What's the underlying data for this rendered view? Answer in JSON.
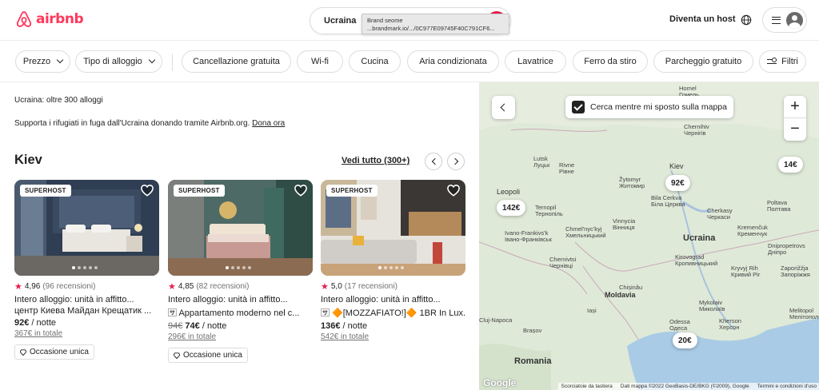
{
  "brand": {
    "name": "airbnb",
    "color": "#ff385c"
  },
  "search": {
    "location": "Ucraina"
  },
  "tooltip": {
    "line1": "Brand seome",
    "line2": "...brandmark.io/.../0C977E09745F40C791CF6..."
  },
  "header": {
    "host_label": "Diventa un host"
  },
  "filters": [
    {
      "label": "Prezzo"
    },
    {
      "label": "Tipo di alloggio"
    },
    {
      "label": "Cancellazione gratuita"
    },
    {
      "label": "Wi-fi"
    },
    {
      "label": "Cucina"
    },
    {
      "label": "Aria condizionata"
    },
    {
      "label": "Lavatrice"
    },
    {
      "label": "Ferro da stiro"
    },
    {
      "label": "Parcheggio gratuito"
    },
    {
      "label": "Filtri"
    }
  ],
  "results": {
    "count": "Ucraina: oltre 300 alloggi",
    "support_text": "Supporta i rifugiati in fuga dall'Ucraina donando tramite Airbnb.org.",
    "support_link": "Dona ora"
  },
  "section": {
    "title": "Kiev",
    "see_all": "Vedi tutto (300+)"
  },
  "listings": [
    {
      "badge": "SUPERHOST",
      "rating": "4,96",
      "reviews": "(96 recensioni)",
      "title": "Intero alloggio: unità in affitto...",
      "subtitle": "центр Киева Майдан Крещатик ...",
      "old_price": "",
      "price": "92€",
      "per": "/ notte",
      "total": "367€ in totale",
      "tag": "Occasione unica"
    },
    {
      "badge": "SUPERHOST",
      "rating": "4,85",
      "reviews": "(82 recensioni)",
      "title": "Intero alloggio: unità in affitto...",
      "subtitle": "🈂 Appartamento moderno nel c...",
      "old_price": "94€",
      "price": "74€",
      "per": "/ notte",
      "total": "296€ in totale",
      "tag": "Occasione unica"
    },
    {
      "badge": "SUPERHOST",
      "rating": "5,0",
      "reviews": "(17 recensioni)",
      "title": "Intero alloggio: unità in affitto...",
      "subtitle": "🈂 🔶[MOZZAFIATO!]🔶 1BR In Lux...",
      "old_price": "",
      "price": "136€",
      "per": "/ notte",
      "total": "542€ in totale",
      "tag": ""
    }
  ],
  "map": {
    "search_moving": "Cerca mentre mi sposto sulla mappa",
    "zoom_in": "+",
    "zoom_out": "−",
    "pins": [
      "92€",
      "142€",
      "14€",
      "20€"
    ],
    "labels": {
      "homel": "Homel\nГомель",
      "chernihiv": "Chernihiv\nЧернігів",
      "lutsk": "Lutsk\nЛуцьк",
      "rivne": "Rivne\nРівне",
      "zhytomyr": "Žytomyr\nЖитомир",
      "kiev": "Kiev",
      "leopoli": "Leopoli",
      "bila": "Bila Cerkva\nБіла Церква",
      "ternopil": "Ternopil\nТернопіль",
      "cherkasy": "Cherkasy\nЧеркаси",
      "poltava": "Poltava\nПолтава",
      "ivano": "Ivano-Frankivs'k\nІвано-Франківськ",
      "khmel": "Chmel'nyc'kyj\nХмельницький",
      "vinnycia": "Vinnycia\nВінниця",
      "kremenchuk": "Kremenčuk\nКременчук",
      "ucraina": "Ucraina",
      "dnipro": "Dnipropetrovs\nДніпро",
      "chernivtsi": "Chernivtsi\nЧернівці",
      "kirovograd": "Kirovograd\nКропивницький",
      "kryvyi": "Kryvyj Rih\nКривий Ріг",
      "zaporizh": "Zaporižžja\nЗапоріжжя",
      "moldavia": "Moldavia",
      "chisinau": "Chișinău",
      "iasi": "Iași",
      "mykolaiv": "Mykolaiv\nМиколаїв",
      "cluj": "Cluj-Napoca",
      "odessa": "Odessa\nОдеса",
      "kherson": "Kherson\nХерсон",
      "melitopol": "Melitopol\nМелітополь",
      "brasov": "Brașov",
      "romania": "Romania"
    },
    "attribution": {
      "shortcuts": "Scorciatoie da tastiera",
      "data": "Dati mappa ©2022 GeoBasis-DE/BKG (©2009), Google",
      "terms": "Termini e condizioni d'uso"
    },
    "google": "Google"
  }
}
